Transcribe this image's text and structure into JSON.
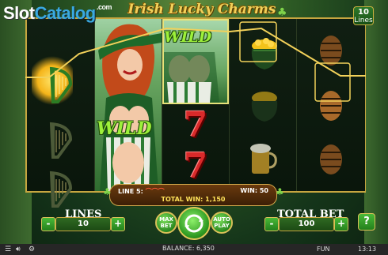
{
  "watermark": {
    "part1": "Slot",
    "part2": "Catalog",
    "suffix": ".com"
  },
  "game": {
    "title": "Irish Lucky Charms"
  },
  "lines_badge": {
    "value": "10",
    "label": "Lines"
  },
  "reels": {
    "wild_label": "WILD",
    "symbols": [
      [
        "harp",
        "harp",
        "harp"
      ],
      [
        "wild-girl",
        "wild-girl",
        "wild-girl"
      ],
      [
        "wild-girl",
        "seven",
        "seven"
      ],
      [
        "pot-of-gold",
        "pot-of-gold",
        "beer-mug"
      ],
      [
        "barrel",
        "barrel",
        "barrel"
      ]
    ]
  },
  "win_info": {
    "line_label": "LINE 5:",
    "win_label": "WIN:",
    "win_value": "50",
    "total_win_label": "TOTAL WIN:",
    "total_win_value": "1,150"
  },
  "controls": {
    "lines_label": "LINES",
    "lines_value": "10",
    "minus": "-",
    "plus": "+",
    "max_bet_label": "MAX BET",
    "auto_play_label": "AUTO PLAY",
    "total_bet_label": "TOTAL BET",
    "total_bet_value": "100",
    "help": "?"
  },
  "status_bar": {
    "balance_label": "BALANCE:",
    "balance_value": "6,350",
    "mode": "FUN",
    "time": "13:13"
  },
  "colors": {
    "frame": "#c7a640",
    "accent_green": "#4ab938",
    "win_line": "#f2d15a",
    "seven_red": "#d92a2a"
  }
}
